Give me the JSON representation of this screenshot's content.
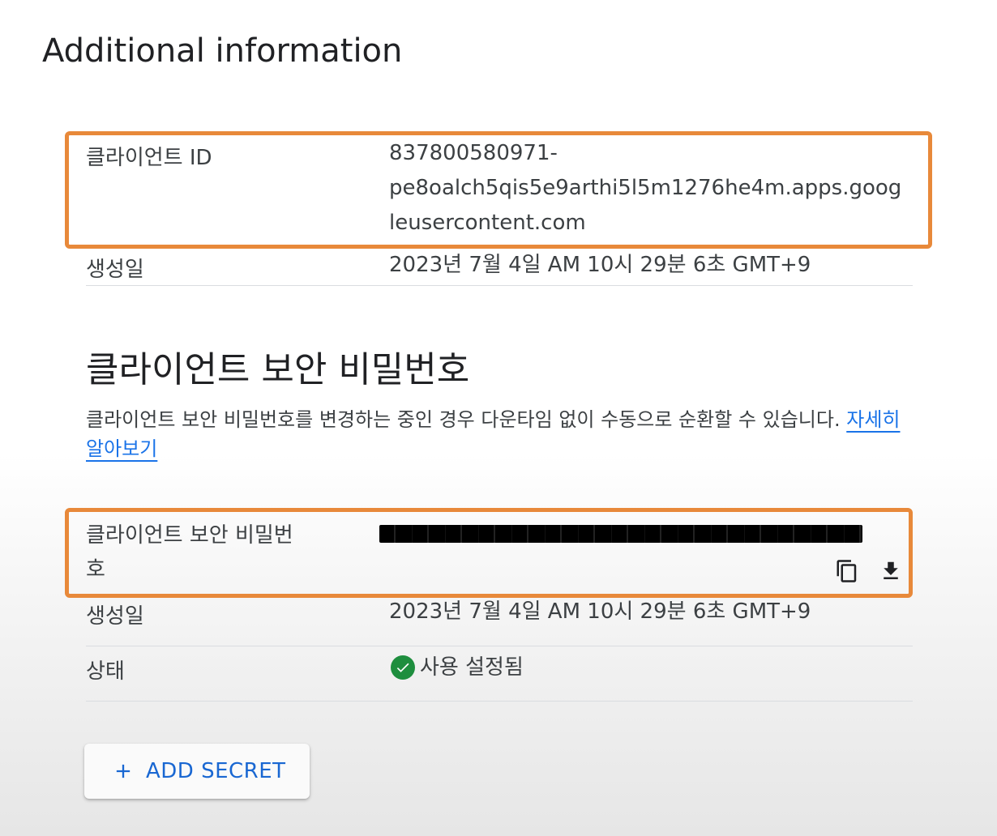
{
  "page_title": "Additional information",
  "client_id": {
    "label": "클라이언트 ID",
    "value_line1": "837800580971-",
    "value_line2": "pe8oalch5qis5e9arthi5l5m1276he4m.apps.goog",
    "value_line3": "leusercontent.com"
  },
  "client_created": {
    "label": "생성일",
    "value": "2023년 7월 4일 AM 10시 29분 6초 GMT+9"
  },
  "secret_section": {
    "title": "클라이언트 보안 비밀번호",
    "description": "클라이언트 보안 비밀번호를 변경하는 중인 경우 다운타임 없이 수동으로 순환할 수 있습니다.",
    "learn_more": "자세히 알아보기"
  },
  "secret": {
    "label_line1": "클라이언트 보안 비밀번",
    "label_line2": "호",
    "copy_icon": "copy-icon",
    "download_icon": "download-icon"
  },
  "secret_created": {
    "label": "생성일",
    "value": "2023년 7월 4일 AM 10시 29분 6초 GMT+9"
  },
  "status": {
    "label": "상태",
    "value": "사용 설정됨",
    "icon": "check-circle-icon",
    "color": "#1e8e3e"
  },
  "add_secret": {
    "label": "ADD SECRET",
    "icon": "plus-icon",
    "color": "#1967d2"
  },
  "highlight_color": "#e8893a"
}
